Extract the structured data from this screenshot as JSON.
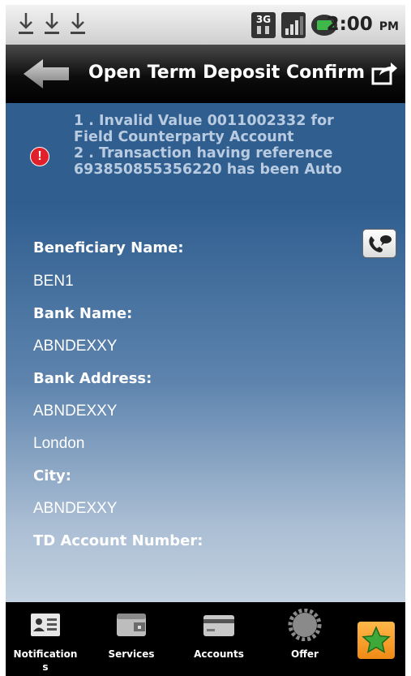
{
  "status_bar": {
    "time": "2:00",
    "time_suffix": "PM",
    "icons": [
      "download-icon",
      "download-icon",
      "download-icon",
      "3g-icon",
      "signal-icon",
      "battery-icon"
    ]
  },
  "header": {
    "title": "Open Term Deposit Confirm",
    "back_icon": "back-arrow-icon",
    "share_icon": "share-icon"
  },
  "error": {
    "icon": "error-icon",
    "lines": [
      "1 . Invalid Value 0011002332 for",
      "Field Counterparty Account",
      "2 . Transaction having reference",
      "693850855356220 has been Auto"
    ]
  },
  "details": {
    "call_icon": "call-support-icon",
    "beneficiary_name_label": "Beneficiary Name:",
    "beneficiary_name_value": "BEN1",
    "bank_name_label": "Bank Name:",
    "bank_name_value": "ABNDEXXY",
    "bank_address_label": "Bank Address:",
    "bank_address_line1": "ABNDEXXY",
    "bank_address_line2": "London",
    "city_label": "City:",
    "city_value": "ABNDEXXY",
    "td_account_label": "TD Account Number:"
  },
  "nav": {
    "items": [
      {
        "label_line1": "Notification",
        "label_line2": "s",
        "icon": "contact-card-icon"
      },
      {
        "label": "Services",
        "icon": "wallet-icon"
      },
      {
        "label": "Accounts",
        "icon": "card-icon"
      },
      {
        "label": "Offer",
        "icon": "gear-icon"
      }
    ],
    "favorite_icon": "star-icon"
  },
  "colors": {
    "accent_blue": "#2f5e8f",
    "error_red": "#e0202a",
    "favorite_orange": "#f08a16",
    "star_green": "#3fa83a"
  }
}
